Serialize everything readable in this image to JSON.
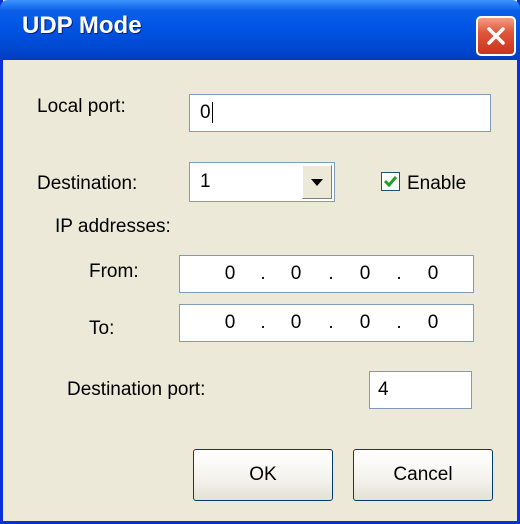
{
  "window": {
    "title": "UDP Mode"
  },
  "local_port": {
    "label": "Local port:",
    "value": "0"
  },
  "destination": {
    "label": "Destination:",
    "selected": "1",
    "enable_label": "Enable",
    "enable_checked": true
  },
  "ip_addresses": {
    "label": "IP addresses:",
    "from_label": "From:",
    "from": [
      "0",
      "0",
      "0",
      "0"
    ],
    "to_label": "To:",
    "to": [
      "0",
      "0",
      "0",
      "0"
    ],
    "separator": "."
  },
  "destination_port": {
    "label": "Destination port:",
    "value": "4"
  },
  "buttons": {
    "ok": "OK",
    "cancel": "Cancel"
  },
  "icons": {
    "close": "close-icon",
    "dropdown": "chevron-down-icon",
    "check": "checkmark-icon"
  },
  "colors": {
    "titlebar": "#0055e5",
    "dialog_background": "#ece9d8",
    "close_button": "#e0563a"
  }
}
